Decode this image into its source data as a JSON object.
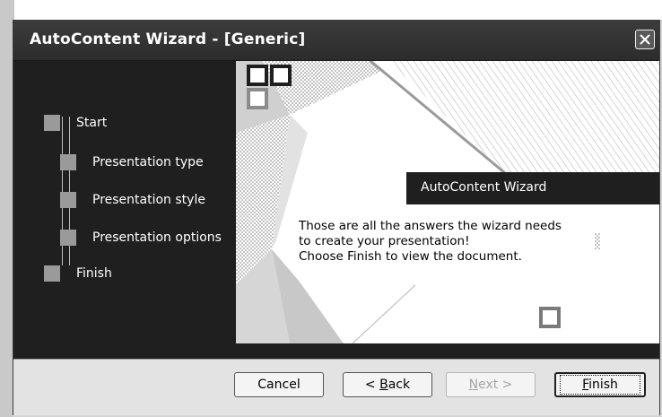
{
  "window": {
    "title": "AutoContent Wizard - [Generic]",
    "close_label": "close"
  },
  "steps": [
    {
      "label": "Start"
    },
    {
      "label": "Presentation type"
    },
    {
      "label": "Presentation style"
    },
    {
      "label": "Presentation options"
    },
    {
      "label": "Finish"
    }
  ],
  "panel": {
    "heading": "AutoContent Wizard",
    "message_line1": "Those are all the answers the wizard needs",
    "message_line2": "to create your presentation!",
    "message_line3": "Choose Finish to view the document."
  },
  "buttons": {
    "cancel": "Cancel",
    "back_prefix": "< ",
    "back_mnemonic": "B",
    "back_rest": "ack",
    "next_mnemonic": "N",
    "next_rest": "ext >",
    "finish_mnemonic": "F",
    "finish_rest": "inish"
  },
  "colors": {
    "window_bg": "#1f1f1f",
    "panel_bg": "#ffffff",
    "footer_bg": "#e3e3e3",
    "step_box": "#9a9a9a"
  }
}
